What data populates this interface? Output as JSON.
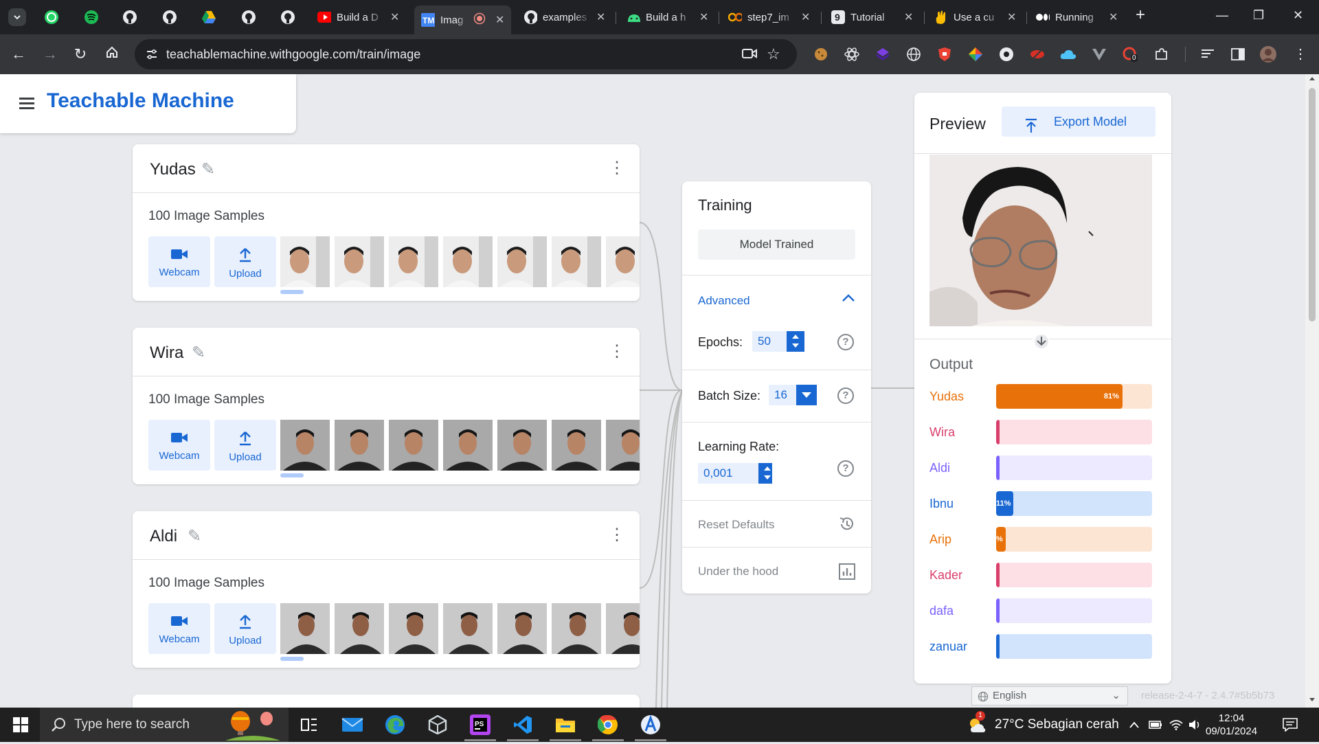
{
  "browser": {
    "tabs": [
      {
        "title": "Build a D"
      },
      {
        "title": "Imag"
      },
      {
        "title": "examples"
      },
      {
        "title": "Build a h"
      },
      {
        "title": "step7_im"
      },
      {
        "title": "Tutorial"
      },
      {
        "title": "Use a cu"
      },
      {
        "title": "Running"
      }
    ],
    "url": "teachablemachine.withgoogle.com/train/image",
    "extension_badge": "0"
  },
  "app": {
    "brand": "Teachable Machine",
    "classes": [
      {
        "name": "Yudas",
        "samples": "100 Image Samples",
        "webcam": "Webcam",
        "upload": "Upload"
      },
      {
        "name": "Wira",
        "samples": "100 Image Samples",
        "webcam": "Webcam",
        "upload": "Upload"
      },
      {
        "name": "Aldi",
        "samples": "100 Image Samples",
        "webcam": "Webcam",
        "upload": "Upload"
      }
    ],
    "training": {
      "title": "Training",
      "status_button": "Model Trained",
      "advanced": "Advanced",
      "epochs_label": "Epochs:",
      "epochs_value": "50",
      "batch_label": "Batch Size:",
      "batch_value": "16",
      "lr_label": "Learning Rate:",
      "lr_value": "0,001",
      "reset": "Reset Defaults",
      "under_hood": "Under the hood"
    },
    "preview": {
      "title": "Preview",
      "export": "Export Model",
      "output_title": "Output",
      "outputs": [
        {
          "label": "Yudas",
          "fraction": 0.81,
          "pct_label": "81%",
          "color": "#e8710a",
          "track": "#fde5d3"
        },
        {
          "label": "Wira",
          "fraction": 0.0,
          "pct_label": "",
          "color": "#d93f6b",
          "track": "#fde0e6"
        },
        {
          "label": "Aldi",
          "fraction": 0.0,
          "pct_label": "",
          "color": "#7b61ff",
          "track": "#ede9fe"
        },
        {
          "label": "Ibnu",
          "fraction": 0.11,
          "pct_label": "11%",
          "color": "#1967d2",
          "track": "#d2e3fc"
        },
        {
          "label": "Arip",
          "fraction": 0.06,
          "pct_label": "%",
          "color": "#e8710a",
          "track": "#fde5d3"
        },
        {
          "label": "Kader",
          "fraction": 0.01,
          "pct_label": "",
          "color": "#d93f6b",
          "track": "#fde0e6"
        },
        {
          "label": "dafa",
          "fraction": 0.0,
          "pct_label": "",
          "color": "#7b61ff",
          "track": "#ede9fe"
        },
        {
          "label": "zanuar",
          "fraction": 0.0,
          "pct_label": "",
          "color": "#1967d2",
          "track": "#d2e3fc"
        }
      ]
    },
    "language": "English",
    "release": "release-2-4-7 - 2.4.7#5b5b73"
  },
  "taskbar": {
    "search_placeholder": "Type here to search",
    "weather": "27°C  Sebagian cerah",
    "notification_badge": "1",
    "time": "12:04",
    "date": "09/01/2024"
  }
}
